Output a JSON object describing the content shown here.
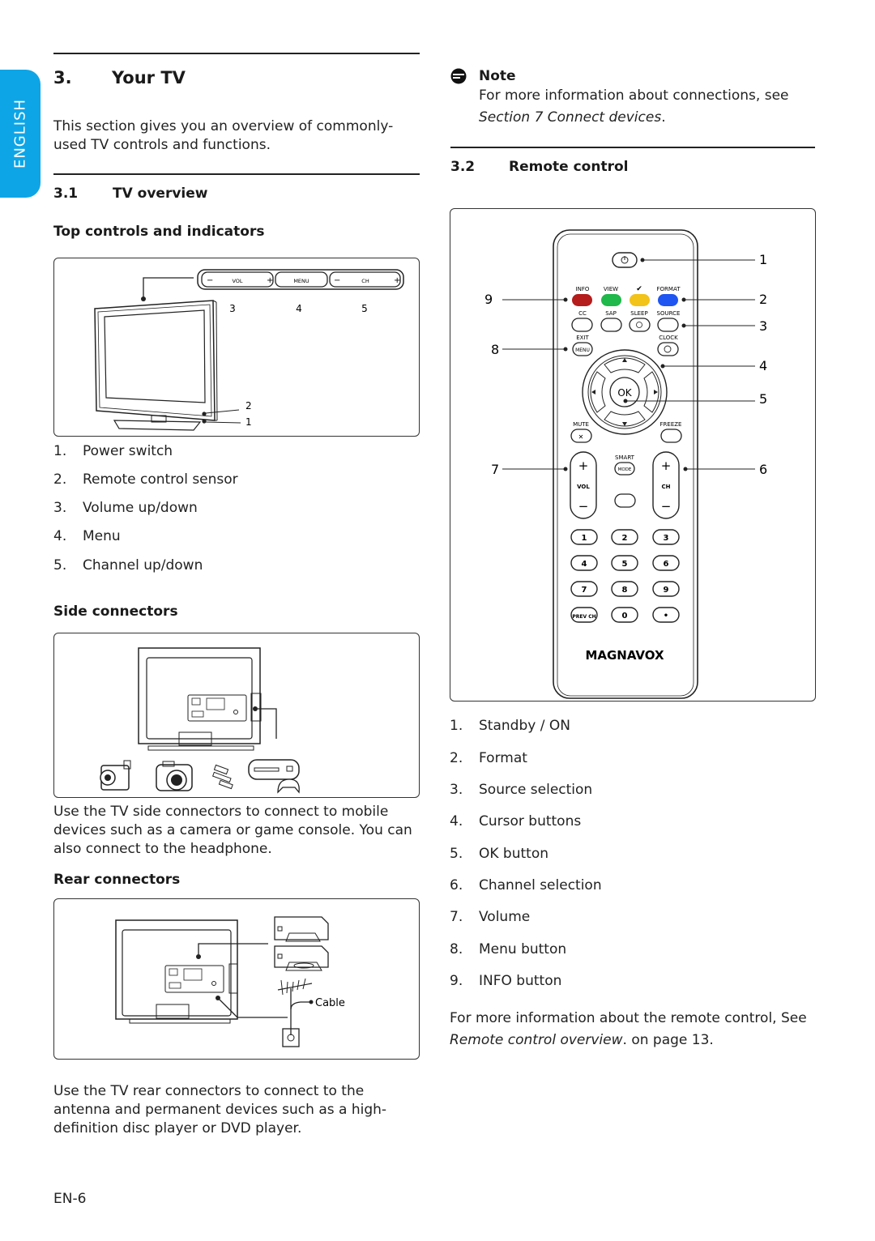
{
  "sidebar_tab": {
    "label": "ENGLISH",
    "color": "#0ea5e6"
  },
  "section": {
    "number": "3.",
    "title": "Your TV",
    "intro": [
      "This section gives you an overview of commonly-",
      "used TV controls and functions."
    ]
  },
  "tv_overview": {
    "number": "3.1",
    "title": "TV overview",
    "top_controls": {
      "heading": "Top controls and indicators",
      "diagram": {
        "buttons": {
          "vol": "VOL",
          "menu": "MENU",
          "ch": "CH",
          "minus": "−",
          "plus": "+"
        },
        "callouts": [
          "1",
          "2",
          "3",
          "4",
          "5"
        ]
      },
      "items": [
        {
          "num": "1.",
          "label": "Power switch"
        },
        {
          "num": "2.",
          "label": "Remote control sensor"
        },
        {
          "num": "3.",
          "label": "Volume up/down"
        },
        {
          "num": "4.",
          "label": "Menu"
        },
        {
          "num": "5.",
          "label": "Channel up/down"
        }
      ]
    },
    "side_connectors": {
      "heading": "Side connectors",
      "description": [
        "Use the TV side connectors to connect to mobile",
        "devices such as a camera or game console. You can",
        "also connect to the headphone."
      ]
    },
    "rear_connectors": {
      "heading": "Rear connectors",
      "cable_label": "Cable",
      "description": [
        "Use the TV rear connectors to connect to the",
        "antenna and permanent devices such as a high-",
        "definition disc player or DVD player."
      ]
    }
  },
  "note": {
    "title": "Note",
    "text": "For more information about connections, see",
    "link": "Section 7 Connect devices",
    "link_suffix": "."
  },
  "remote_control": {
    "number": "3.2",
    "title": "Remote control",
    "diagram": {
      "brand": "MAGNAVOX",
      "color_buttons": [
        {
          "label": "INFO",
          "color": "#b51c1c"
        },
        {
          "label": "VIEW",
          "color": "#1fb84a"
        },
        {
          "label": "✔",
          "color": "#f2c318"
        },
        {
          "label": "FORMAT",
          "color": "#1f55f0"
        }
      ],
      "row2_labels": [
        "CC",
        "SAP",
        "SLEEP",
        "SOURCE"
      ],
      "exit_label": "EXIT",
      "menu_label": "MENU",
      "clock_label": "CLOCK",
      "ok_label": "OK",
      "mute_label": "MUTE",
      "freeze_label": "FREEZE",
      "smart_label": "SMART",
      "mode_label": "MODE",
      "vol_label": "VOL",
      "ch_label": "CH",
      "plus": "+",
      "minus": "−",
      "keypad": [
        "1",
        "2",
        "3",
        "4",
        "5",
        "6",
        "7",
        "8",
        "9",
        "PREV CH",
        "0",
        "•"
      ],
      "callouts": [
        "1",
        "2",
        "3",
        "4",
        "5",
        "6",
        "7",
        "8",
        "9"
      ]
    },
    "items": [
      {
        "num": "1.",
        "label": "Standby / ON"
      },
      {
        "num": "2.",
        "label": "Format"
      },
      {
        "num": "3.",
        "label": "Source selection"
      },
      {
        "num": "4.",
        "label": "Cursor buttons"
      },
      {
        "num": "5.",
        "label": "OK button"
      },
      {
        "num": "6.",
        "label": "Channel selection"
      },
      {
        "num": "7.",
        "label": "Volume"
      },
      {
        "num": "8.",
        "label": "Menu button"
      },
      {
        "num": "9.",
        "label": "INFO button"
      }
    ],
    "more_info": "For more information about the remote control, See",
    "more_link": "Remote control overview",
    "more_suffix": ". on page 13."
  },
  "footer": {
    "page": "EN-6"
  }
}
